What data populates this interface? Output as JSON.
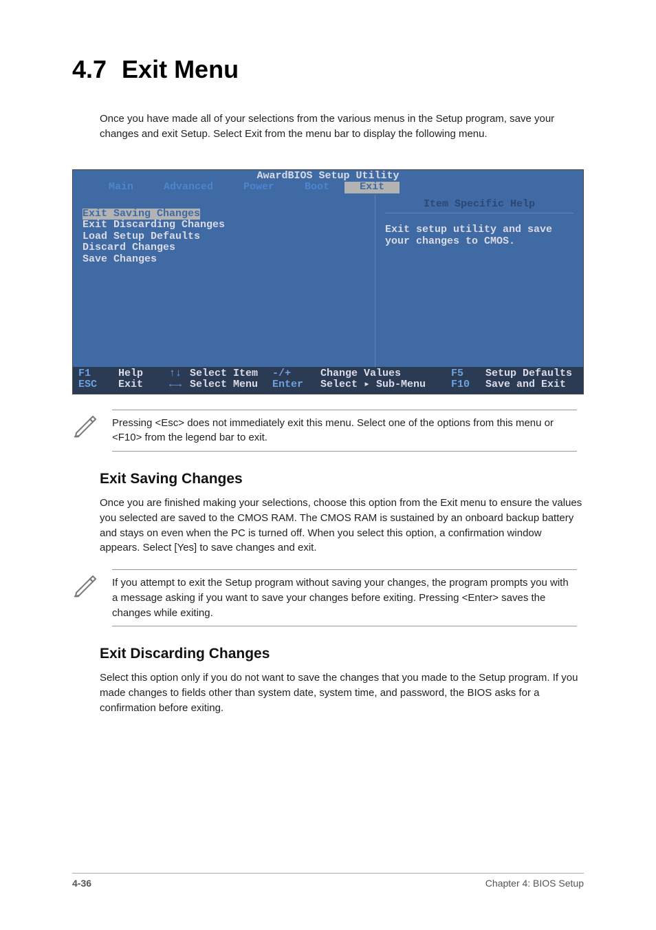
{
  "heading": {
    "number": "4.7",
    "title": "Exit Menu"
  },
  "intro": "Once you have made all of your selections from the various menus in the Setup program, save your changes and exit Setup. Select Exit from the menu bar to display the following menu.",
  "bios": {
    "title": "AwardBIOS Setup Utility",
    "tabs": [
      "Main",
      "Advanced",
      "Power",
      "Boot",
      "Exit"
    ],
    "active_tab": "Exit",
    "items": [
      "Exit Saving Changes",
      "Exit Discarding Changes",
      "Load Setup Defaults",
      "Discard Changes",
      "Save Changes"
    ],
    "selected_item": "Exit Saving Changes",
    "help_title": "Item Specific Help",
    "help_text": "Exit setup utility and save your changes to CMOS.",
    "footer": {
      "r1k1": "F1",
      "r1l1": "Help",
      "r1a1": "↑↓",
      "r1m1": "Select Item",
      "r1k2": "-/+",
      "r1m2": "Change Values",
      "r1k3": "F5",
      "r1l3": "Setup Defaults",
      "r2k1": "ESC",
      "r2l1": "Exit",
      "r2a1": "←→",
      "r2m1": "Select Menu",
      "r2k2": "Enter",
      "r2m2": "Select ▸ Sub-Menu",
      "r2k3": "F10",
      "r2l3": "Save and Exit"
    }
  },
  "note1": "Pressing <Esc> does not immediately exit this menu. Select one of the options from this menu or <F10> from the legend bar to exit.",
  "sec1": {
    "head": "Exit Saving Changes",
    "para": "Once you are finished making your selections, choose this option from the Exit menu to ensure the values you selected are saved to the CMOS RAM. The CMOS RAM is sustained by an onboard backup battery and stays on even when the PC is turned off. When you select this option, a confirmation window appears. Select [Yes] to save changes and exit."
  },
  "note2": "If you attempt to exit the Setup program without saving your changes, the program prompts you with a message asking if you want to save your changes before exiting. Pressing <Enter> saves the changes while exiting.",
  "sec2": {
    "head": "Exit Discarding Changes",
    "para": "Select this option only if you do not want to save the changes that you made to the Setup program. If you made changes to fields other than system date, system time, and password, the BIOS asks for a confirmation before exiting."
  },
  "footer": {
    "left": "4-36",
    "right": "Chapter 4: BIOS Setup"
  }
}
